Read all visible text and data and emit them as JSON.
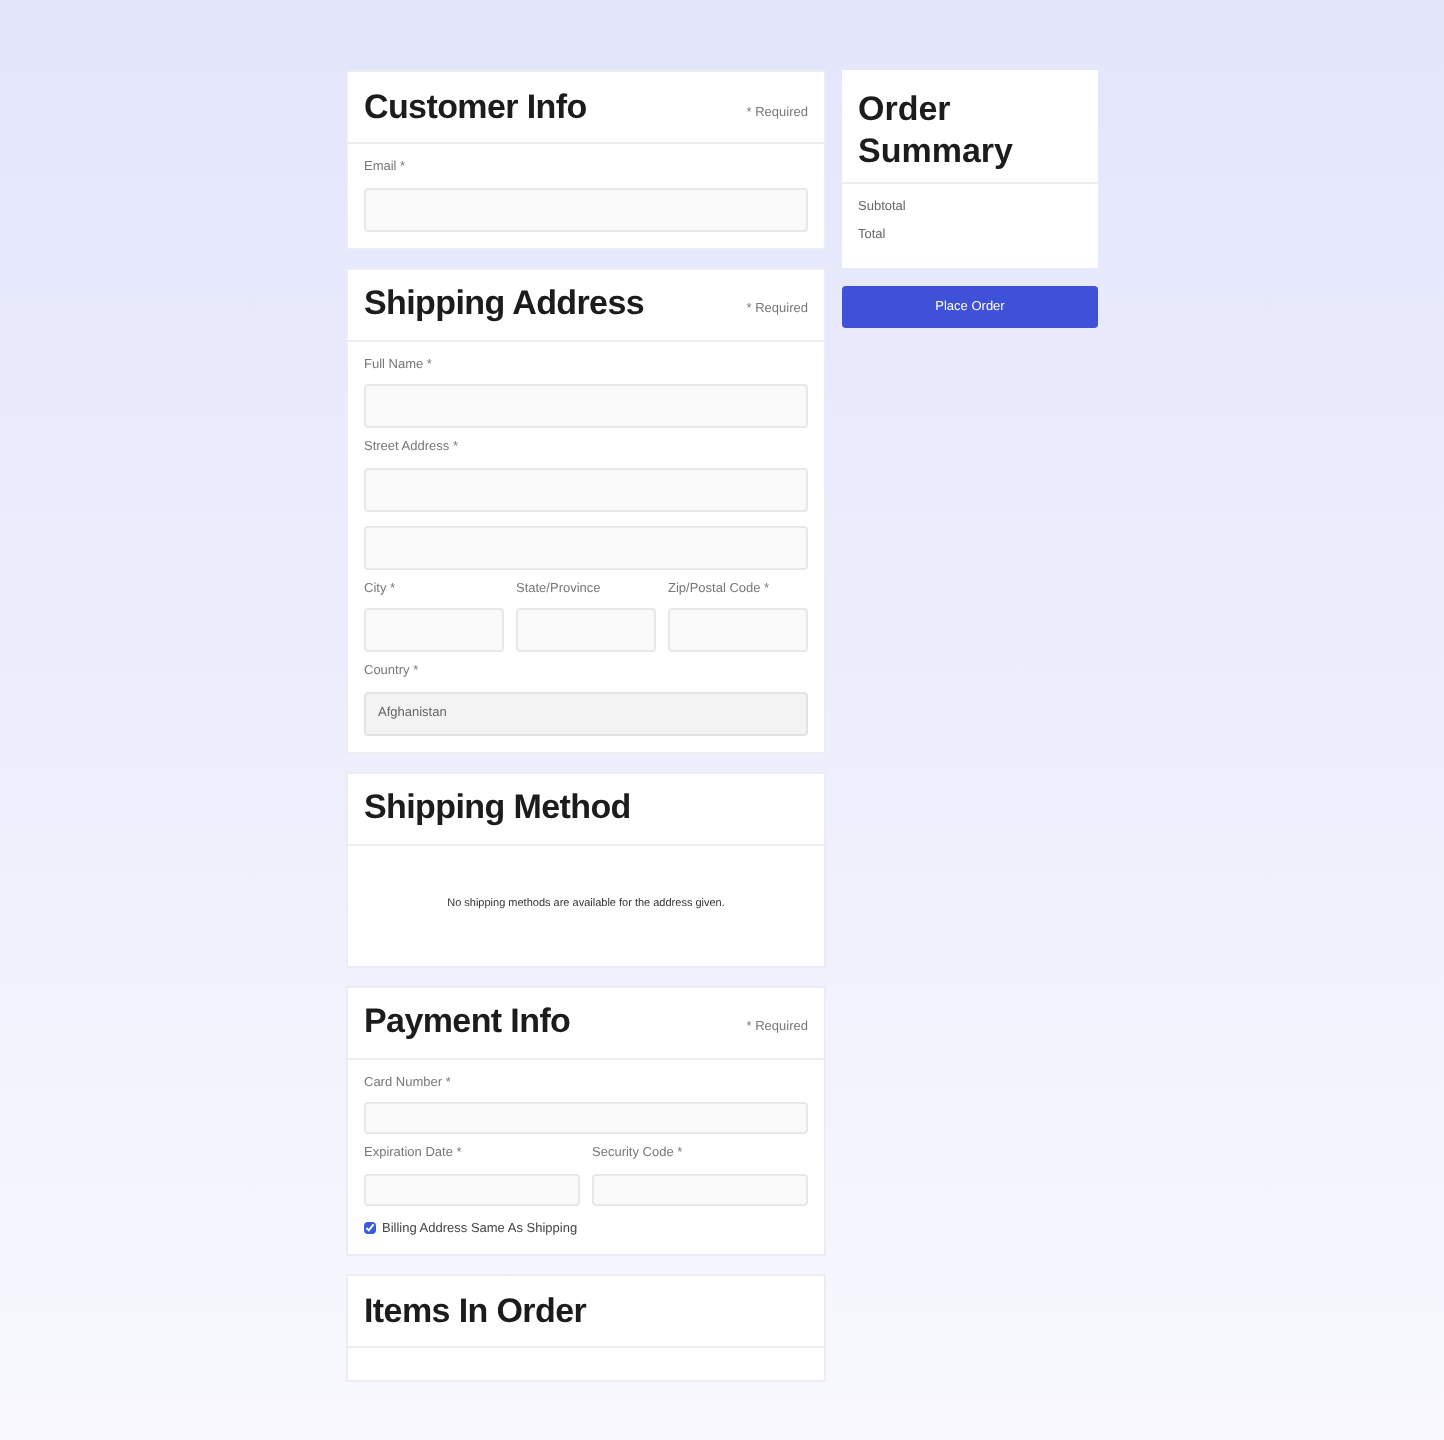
{
  "sections": [
    {
      "title": "Customer Info",
      "required": "* Required",
      "rows": [
        [
          {
            "label": "Email *",
            "kind": "input"
          }
        ]
      ]
    },
    {
      "title": "Shipping Address",
      "required": "* Required",
      "rows": [
        [
          {
            "label": "Full Name *",
            "kind": "input"
          }
        ],
        [
          {
            "label": "Street Address *",
            "kind": "input"
          }
        ],
        [
          {
            "kind": "input"
          }
        ],
        [
          {
            "label": "City *",
            "kind": "input"
          },
          {
            "label": "State/Province",
            "kind": "input"
          },
          {
            "label": "Zip/Postal Code *",
            "kind": "input"
          }
        ],
        [
          {
            "label": "Country *",
            "kind": "select",
            "value": "Afghanistan"
          }
        ]
      ]
    },
    {
      "title": "Shipping Method",
      "message": "No shipping methods are available for the address given."
    },
    {
      "title": "Payment Info",
      "required": "* Required",
      "rows": [
        [
          {
            "label": "Card Number *",
            "kind": "short"
          }
        ],
        [
          {
            "label": "Expiration Date *",
            "kind": "short"
          },
          {
            "label": "Security Code *",
            "kind": "short"
          }
        ]
      ],
      "checkbox": {
        "label": "Billing Address Same As Shipping",
        "checked": true
      }
    },
    {
      "title": "Items In Order"
    }
  ],
  "summary": {
    "title": "Order Summary",
    "lines": [
      "Subtotal",
      "Total"
    ]
  },
  "place_order": "Place Order"
}
